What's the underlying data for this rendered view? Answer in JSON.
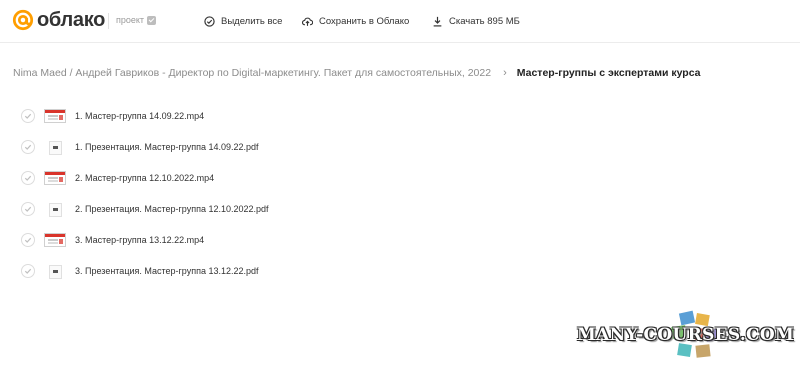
{
  "header": {
    "logo_text": "облако",
    "project_label": "проект",
    "select_all": "Выделить все",
    "save_to_cloud": "Сохранить в Облако",
    "download": "Скачать 895 МБ"
  },
  "breadcrumb": {
    "parent": "Nima Maed / Андрей Гавриков - Директор по Digital-маркетингу. Пакет для самостоятельных, 2022",
    "separator": "›",
    "current": "Мастер-группы с экспертами курса"
  },
  "files": [
    {
      "name": "1. Мастер-группа 14.09.22.mp4",
      "type": "video"
    },
    {
      "name": "1. Презентация. Мастер-группа 14.09.22.pdf",
      "type": "pdf"
    },
    {
      "name": "2. Мастер-группа 12.10.2022.mp4",
      "type": "video"
    },
    {
      "name": "2. Презентация. Мастер-группа 12.10.2022.pdf",
      "type": "pdf"
    },
    {
      "name": "3. Мастер-группа 13.12.22.mp4",
      "type": "video"
    },
    {
      "name": "3. Презентация. Мастер-группа 13.12.22.pdf",
      "type": "pdf"
    }
  ],
  "watermark": "MANY-COURSES.COM",
  "colors": {
    "brand_orange": "#ff9e00",
    "accent_red": "#d9342b"
  }
}
